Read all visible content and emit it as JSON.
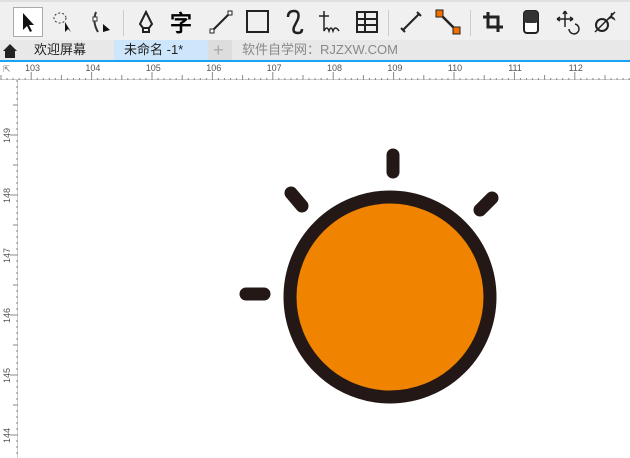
{
  "toolbar": {
    "tools": [
      "pick-tool",
      "freehand-pick-tool",
      "shape-tool",
      "pen-tool",
      "text-tool",
      "line-tool",
      "rectangle-tool",
      "spiral-tool",
      "pointer-tool",
      "table-tool",
      "dimension-tool",
      "connector-tool",
      "crop-tool",
      "eraser-tool",
      "transform-tool",
      "blend-tool"
    ],
    "text_tool_glyph": "字"
  },
  "tabs": {
    "home": "home",
    "welcome": "欢迎屏幕",
    "document": "未命名 -1*",
    "add": "+",
    "watermark": "软件自学网：RJZXW.COM"
  },
  "rulers": {
    "horizontal": [
      "103",
      "104",
      "105",
      "106",
      "107",
      "108",
      "109",
      "110",
      "111",
      "112"
    ],
    "vertical": [
      "149",
      "148",
      "147",
      "146",
      "145",
      "144"
    ]
  },
  "colors": {
    "sun_fill": "#f08300",
    "outline": "#231815",
    "accent": "#1aa3f0"
  }
}
